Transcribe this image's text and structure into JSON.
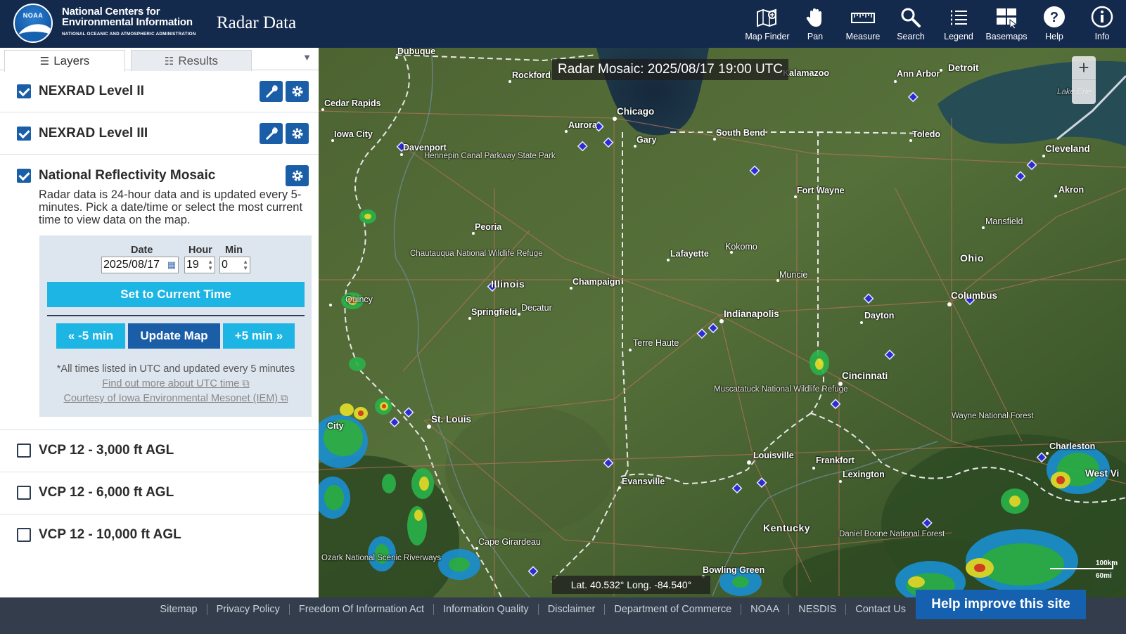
{
  "header": {
    "logo_text": "NOAA",
    "org_line1": "National Centers for",
    "org_line2": "Environmental Information",
    "org_line3": "NATIONAL OCEANIC AND ATMOSPHERIC ADMINISTRATION",
    "app_title": "Radar Data",
    "tools": [
      {
        "label": "Map Finder",
        "icon": "map-finder-icon"
      },
      {
        "label": "Pan",
        "icon": "hand-icon"
      },
      {
        "label": "Measure",
        "icon": "ruler-icon"
      },
      {
        "label": "Search",
        "icon": "search-icon"
      },
      {
        "label": "Legend",
        "icon": "list-icon"
      },
      {
        "label": "Basemaps",
        "icon": "basemaps-icon"
      },
      {
        "label": "Help",
        "icon": "help-icon"
      },
      {
        "label": "Info",
        "icon": "info-icon"
      }
    ]
  },
  "panel": {
    "tabs": [
      {
        "label": "Layers",
        "active": true
      },
      {
        "label": "Results",
        "active": false
      }
    ],
    "layers": [
      {
        "name": "NEXRAD Level II",
        "checked": true
      },
      {
        "name": "NEXRAD Level III",
        "checked": true
      },
      {
        "name": "National Reflectivity Mosaic",
        "checked": true
      },
      {
        "name": "VCP 12 - 3,000 ft AGL",
        "checked": false
      },
      {
        "name": "VCP 12 - 6,000 ft AGL",
        "checked": false
      },
      {
        "name": "VCP 12 - 10,000 ft AGL",
        "checked": false
      }
    ],
    "mosaic": {
      "description": "Radar data is 24-hour data and is updated every 5-minutes. Pick a date/time or select the most current time to view data on the map.",
      "date_label": "Date",
      "hour_label": "Hour",
      "min_label": "Min",
      "date_value": "2025/08/17",
      "hour_value": "19",
      "min_value": "0",
      "set_current_label": "Set to Current Time",
      "minus_label": "« -5 min",
      "update_label": "Update Map",
      "plus_label": "+5 min »",
      "utc_note": "*All times listed in UTC and updated every 5 minutes",
      "utc_link": "Find out more about UTC time",
      "iem_link": "Courtesy of Iowa Environmental Mesonet (IEM)"
    }
  },
  "map": {
    "title": "Radar Mosaic: 2025/08/17 19:00 UTC",
    "coord": "Lat. 40.532°  Long. -84.540°",
    "scale_km": "100km",
    "scale_mi": "60mi",
    "zoom_in": "+",
    "cities": {
      "dubuque": "Dubuque",
      "rockford": "Rockford",
      "kalamazoo": "Kalamazoo",
      "ann_arbor": "Ann Arbor",
      "detroit": "Detroit",
      "cedar_rapids": "Cedar Rapids",
      "chicago": "Chicago",
      "aurora": "Aurora",
      "iowa_city": "Iowa City",
      "gary": "Gary",
      "south_bend": "South Bend",
      "toledo": "Toledo",
      "davenport": "Davenport",
      "cleveland": "Cleveland",
      "fort_wayne": "Fort Wayne",
      "akron": "Akron",
      "peoria": "Peoria",
      "mansfield": "Mansfield",
      "kokomo": "Kokomo",
      "lafayette": "Lafayette",
      "ohio": "Ohio",
      "muncie": "Muncie",
      "champaign": "Champaign",
      "illinois": "Illinois",
      "columbus": "Columbus",
      "quincy": "Quincy",
      "indianapolis": "Indianapolis",
      "dayton": "Dayton",
      "springfield": "Springfield",
      "decatur": "Decatur",
      "terre_haute": "Terre Haute",
      "cincinnati": "Cincinnati",
      "st_louis": "St. Louis",
      "city": "City",
      "charleston": "Charleston",
      "west_v": "West Vi",
      "louisville": "Louisville",
      "frankfort": "Frankfort",
      "lexington": "Lexington",
      "evansville": "Evansville",
      "kentucky": "Kentucky",
      "cape_girardeau": "Cape Girardeau",
      "bowling_green": "Bowling Green",
      "lake_erie": "Lake Erie"
    },
    "parks": {
      "hennepin": "Hennepin Canal Parkway State Park",
      "chautauqua": "Chautauqua National Wildlife Refuge",
      "muscatatuck": "Muscatatuck National Wildlife Refuge",
      "wayne": "Wayne National Forest",
      "daniel_boone": "Daniel Boone National Forest",
      "ozark": "Ozark National Scenic Riverways"
    }
  },
  "footer": {
    "links": [
      "Sitemap",
      "Privacy Policy",
      "Freedom Of Information Act",
      "Information Quality",
      "Disclaimer",
      "Department of Commerce",
      "NOAA",
      "NESDIS",
      "Contact Us"
    ],
    "feedback": "Help improve this site"
  }
}
